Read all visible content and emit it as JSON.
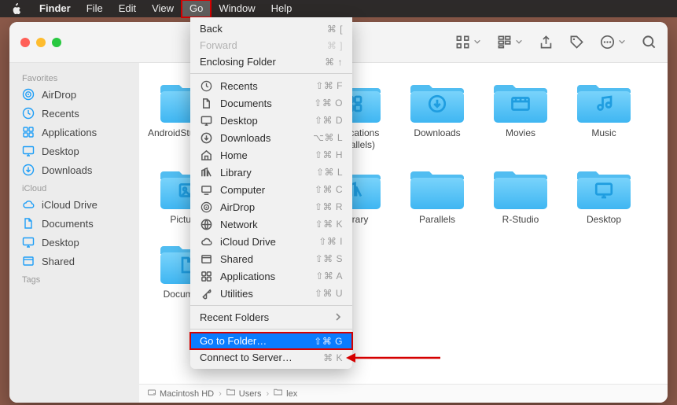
{
  "menubar": {
    "app": "Finder",
    "items": [
      "File",
      "Edit",
      "View",
      "Go",
      "Window",
      "Help"
    ],
    "active": "Go"
  },
  "sidebar": {
    "sections": [
      {
        "title": "Favorites",
        "items": [
          {
            "label": "AirDrop",
            "icon": "airdrop"
          },
          {
            "label": "Recents",
            "icon": "clock"
          },
          {
            "label": "Applications",
            "icon": "apps"
          },
          {
            "label": "Desktop",
            "icon": "desktop"
          },
          {
            "label": "Downloads",
            "icon": "download"
          }
        ]
      },
      {
        "title": "iCloud",
        "items": [
          {
            "label": "iCloud Drive",
            "icon": "cloud"
          },
          {
            "label": "Documents",
            "icon": "doc"
          },
          {
            "label": "Desktop",
            "icon": "desktop"
          },
          {
            "label": "Shared",
            "icon": "shared"
          }
        ]
      },
      {
        "title": "Tags",
        "items": []
      }
    ]
  },
  "folders": {
    "rows": [
      [
        {
          "label": "AndroidStudioProjects",
          "glyph": ""
        },
        {
          "label": "",
          "glyph": ""
        },
        {
          "label": "Applications (Parallels)",
          "glyph": "apps"
        },
        {
          "label": "Downloads",
          "glyph": "download"
        },
        {
          "label": "Movies",
          "glyph": "movie"
        },
        {
          "label": "Music",
          "glyph": "music"
        }
      ],
      [
        {
          "label": "Pictures",
          "glyph": "picture"
        },
        {
          "label": "",
          "glyph": ""
        },
        {
          "label": "Library",
          "glyph": "library"
        },
        {
          "label": "Parallels",
          "glyph": ""
        },
        {
          "label": "R-Studio",
          "glyph": ""
        },
        {
          "label": "Desktop",
          "glyph": "desktop"
        }
      ],
      [
        {
          "label": "Documents",
          "glyph": "doc"
        }
      ]
    ]
  },
  "pathbar": {
    "segs": [
      {
        "label": "Macintosh HD",
        "icon": "disk"
      },
      {
        "label": "Users",
        "icon": "folder"
      },
      {
        "label": "lex",
        "icon": "folder"
      }
    ]
  },
  "go_menu": {
    "row1": [
      {
        "label": "Back",
        "shortcut": "⌘ [",
        "disabled": false
      },
      {
        "label": "Forward",
        "shortcut": "⌘ ]",
        "disabled": true
      },
      {
        "label": "Enclosing Folder",
        "shortcut": "⌘ ↑",
        "disabled": false
      }
    ],
    "row2": [
      {
        "label": "Recents",
        "shortcut": "⇧⌘ F",
        "icon": "clock"
      },
      {
        "label": "Documents",
        "shortcut": "⇧⌘ O",
        "icon": "doc"
      },
      {
        "label": "Desktop",
        "shortcut": "⇧⌘ D",
        "icon": "desktop"
      },
      {
        "label": "Downloads",
        "shortcut": "⌥⌘ L",
        "icon": "download"
      },
      {
        "label": "Home",
        "shortcut": "⇧⌘ H",
        "icon": "home"
      },
      {
        "label": "Library",
        "shortcut": "⇧⌘ L",
        "icon": "library"
      },
      {
        "label": "Computer",
        "shortcut": "⇧⌘ C",
        "icon": "computer"
      },
      {
        "label": "AirDrop",
        "shortcut": "⇧⌘ R",
        "icon": "airdrop"
      },
      {
        "label": "Network",
        "shortcut": "⇧⌘ K",
        "icon": "network"
      },
      {
        "label": "iCloud Drive",
        "shortcut": "⇧⌘ I",
        "icon": "cloud"
      },
      {
        "label": "Shared",
        "shortcut": "⇧⌘ S",
        "icon": "shared"
      },
      {
        "label": "Applications",
        "shortcut": "⇧⌘ A",
        "icon": "apps"
      },
      {
        "label": "Utilities",
        "shortcut": "⇧⌘ U",
        "icon": "utilities"
      }
    ],
    "row3": [
      {
        "label": "Recent Folders",
        "submenu": true
      }
    ],
    "row4": [
      {
        "label": "Go to Folder…",
        "shortcut": "⇧⌘ G",
        "highlight": true
      },
      {
        "label": "Connect to Server…",
        "shortcut": "⌘ K"
      }
    ]
  }
}
